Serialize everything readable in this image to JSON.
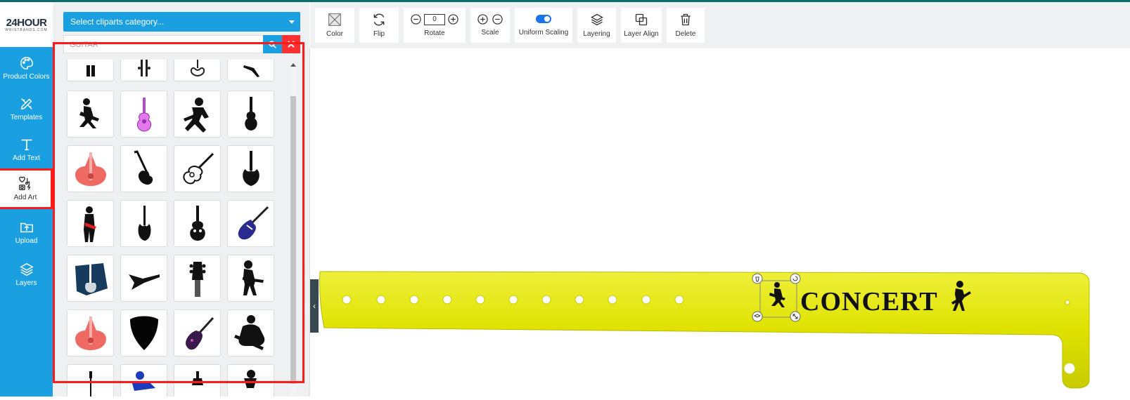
{
  "brand": {
    "logo_text": "24HOUR",
    "logo_sub": "WRISTBANDS.COM"
  },
  "sidebar": {
    "items": [
      {
        "label": "Product Colors",
        "icon": "palette-icon"
      },
      {
        "label": "Templates",
        "icon": "pen-ruler-icon"
      },
      {
        "label": "Add Text",
        "icon": "text-icon"
      },
      {
        "label": "Add Art",
        "icon": "add-art-icon",
        "active": true
      },
      {
        "label": "Upload",
        "icon": "upload-folder-icon"
      },
      {
        "label": "Layers",
        "icon": "layers-icon"
      }
    ]
  },
  "clipart_panel": {
    "category_placeholder": "Select cliparts category...",
    "search_value": "GUITAR"
  },
  "toolbar": {
    "color_label": "Color",
    "flip_label": "Flip",
    "rotate_label": "Rotate",
    "rotate_value": "0",
    "scale_label": "Scale",
    "uniform_scaling_label": "Uniform Scaling",
    "layering_label": "Layering",
    "layer_align_label": "Layer Align",
    "delete_label": "Delete"
  },
  "canvas": {
    "wristband_color": "#e2e400",
    "wristband_text": "CONCERT"
  },
  "colors": {
    "accent": "#1a9fe0",
    "highlight": "#ff1a1a",
    "clear_button": "#ff3030"
  }
}
